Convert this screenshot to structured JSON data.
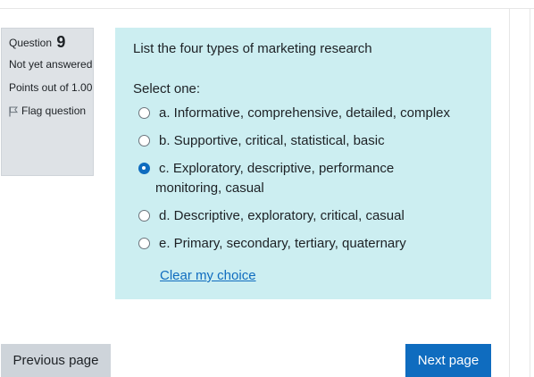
{
  "info": {
    "question_label": "Question",
    "question_number": "9",
    "state": "Not yet answered",
    "grade": "Points out of 1.00",
    "flag_label": "Flag question"
  },
  "question": {
    "text": "List the four types of marketing research",
    "prompt": "Select one:",
    "answers": [
      {
        "label": "a. Informative, comprehensive, detailed, complex",
        "selected": false
      },
      {
        "label": "b. Supportive, critical, statistical, basic",
        "selected": false
      },
      {
        "label": "c. Exploratory, descriptive, performance",
        "label_cont": "monitoring, casual",
        "selected": true
      },
      {
        "label": "d. Descriptive, exploratory, critical, casual",
        "selected": false
      },
      {
        "label": "e. Primary, secondary, tertiary, quaternary",
        "selected": false
      }
    ],
    "clear_label": "Clear my choice"
  },
  "nav": {
    "prev_label": "Previous page",
    "next_label": "Next page"
  },
  "colors": {
    "accent": "#0f6cbf",
    "content_bg": "#cceef1",
    "info_bg": "#dee2e6"
  },
  "icons": {
    "flag": "flag-icon"
  }
}
